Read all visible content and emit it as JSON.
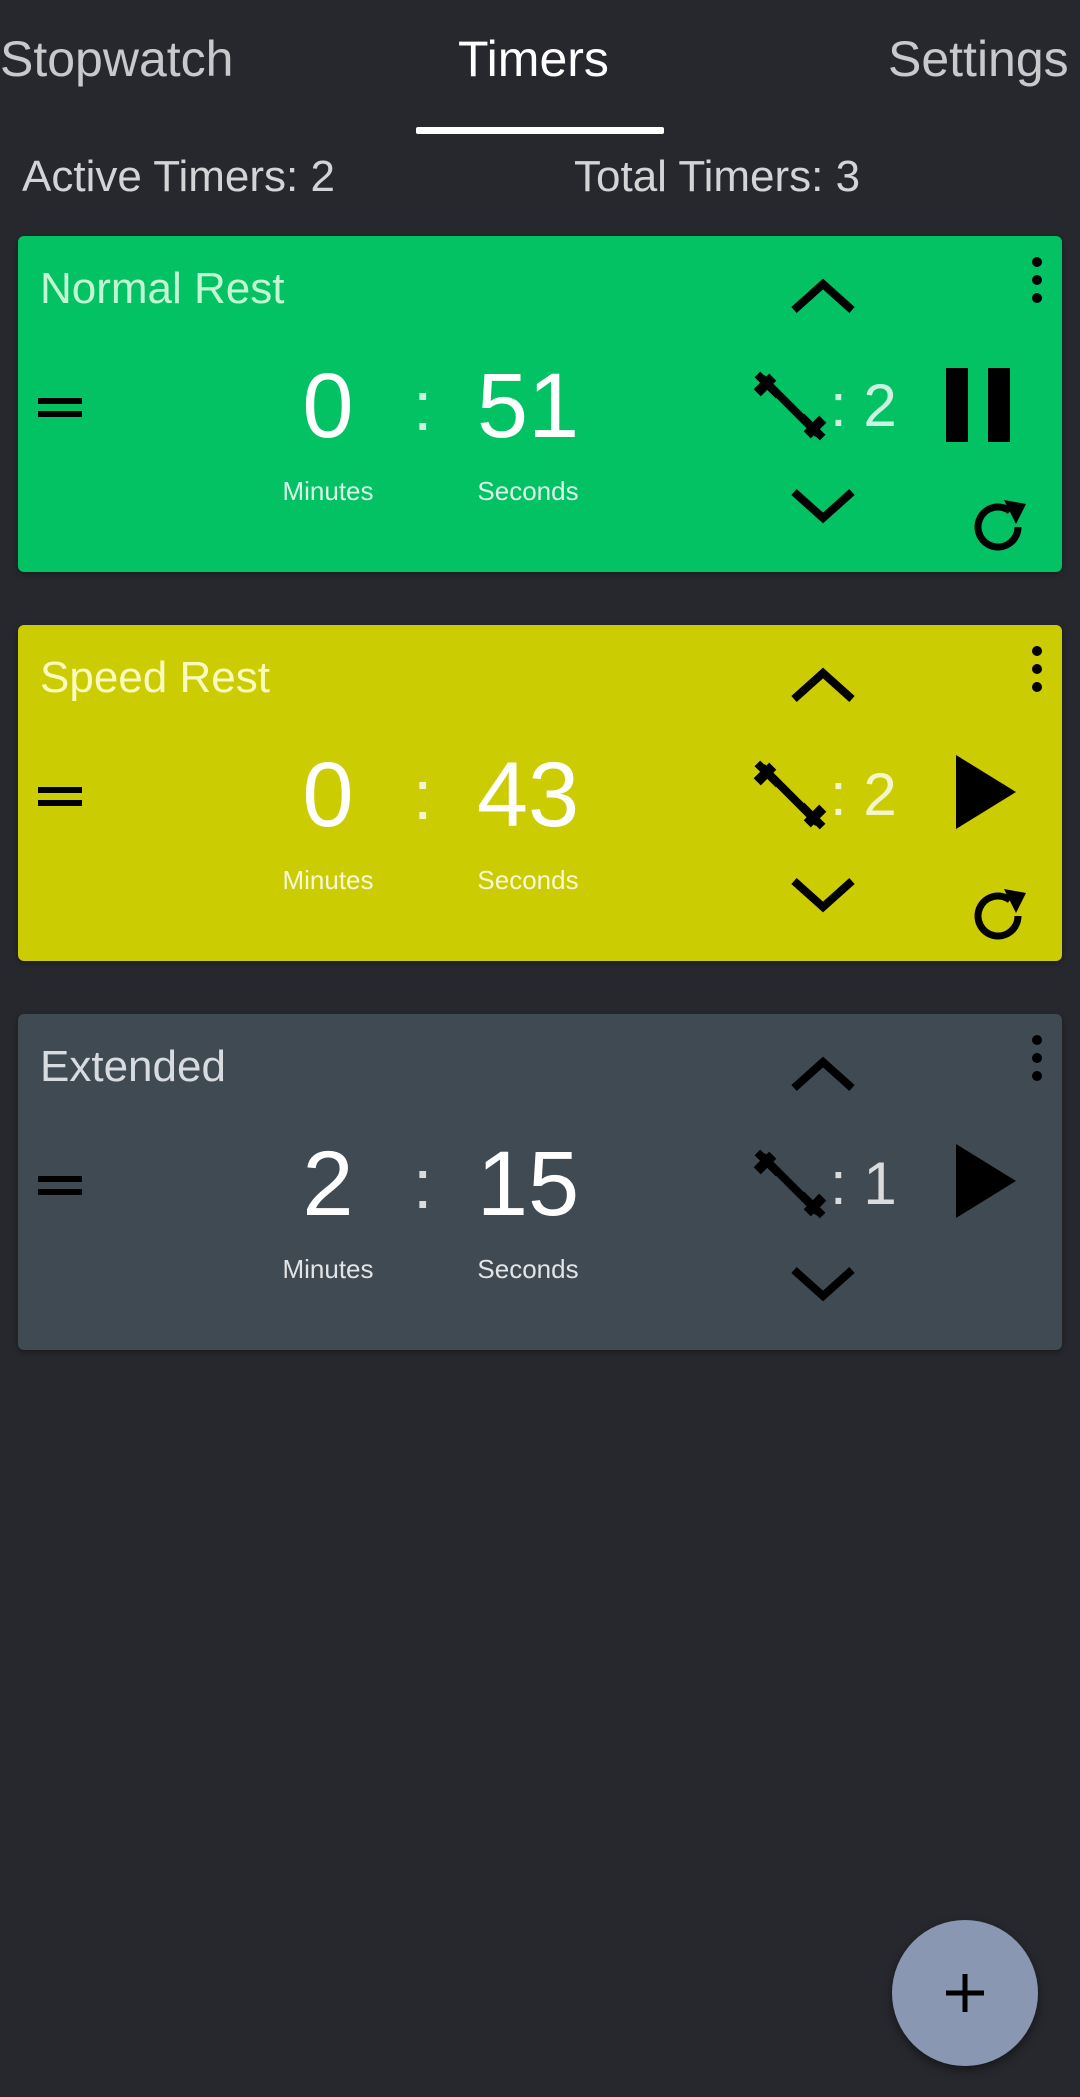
{
  "tabs": [
    {
      "label": "Stopwatch",
      "active": false
    },
    {
      "label": "Timers",
      "active": true
    },
    {
      "label": "Settings",
      "active": false
    }
  ],
  "summary": {
    "active": "Active Timers: 2",
    "total": "Total Timers: 3"
  },
  "timers": [
    {
      "name": "Normal Rest",
      "minutes": "0",
      "seconds": "51",
      "minutes_label": "Minutes",
      "seconds_label": "Seconds",
      "sets": ": 2",
      "state": "running",
      "color": "#03c264",
      "controls": [
        "pause-icon",
        "reset-icon"
      ]
    },
    {
      "name": "Speed Rest",
      "minutes": "0",
      "seconds": "43",
      "minutes_label": "Minutes",
      "seconds_label": "Seconds",
      "sets": ": 2",
      "state": "paused",
      "color": "#cccc02",
      "controls": [
        "play-icon",
        "reset-icon"
      ]
    },
    {
      "name": "Extended",
      "minutes": "2",
      "seconds": "15",
      "minutes_label": "Minutes",
      "seconds_label": "Seconds",
      "sets": ": 1",
      "state": "stopped",
      "color": "#404a53",
      "controls": [
        "play-icon"
      ]
    }
  ],
  "colon": ":",
  "fab": {
    "icon": "plus-icon"
  },
  "icons": {
    "drag": "drag-handle-icon",
    "more": "more-vert-icon",
    "up": "chevron-up-icon",
    "down": "chevron-down-icon",
    "sets": "dumbbell-icon"
  }
}
